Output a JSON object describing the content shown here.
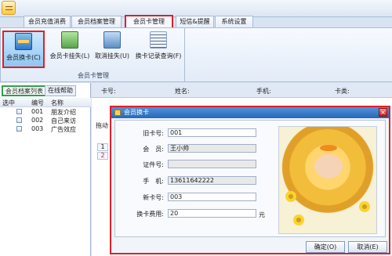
{
  "app": {
    "title_icon": "app-icon",
    "tabs": [
      "会员充值消费",
      "会员档案管理",
      "会员卡管理",
      "短信&提醒",
      "系统设置"
    ],
    "active_tab": "会员卡管理"
  },
  "ribbon": {
    "buttons": [
      "会员换卡(C)",
      "会员卡挂失(L)",
      "取消挂失(U)",
      "换卡记录查询(F)"
    ],
    "group_label": "会员卡管理"
  },
  "left_panel": {
    "tabs": [
      "会员档案列表",
      "在线帮助"
    ],
    "headers": [
      "选中",
      "编号",
      "名称"
    ],
    "rows": [
      {
        "id": "001",
        "name": "朋友介绍"
      },
      {
        "id": "002",
        "name": "自己来访"
      },
      {
        "id": "003",
        "name": "广告效应"
      }
    ]
  },
  "background": {
    "labels": [
      "卡号:",
      "姓名:",
      "手机:",
      "卡类:"
    ],
    "row_numbers": [
      "1",
      "2"
    ],
    "grid_header": "拖动"
  },
  "dialog": {
    "title": "会员换卡",
    "fields": [
      {
        "label": "旧卡号:",
        "value": "001"
      },
      {
        "label": "会　员:",
        "value": "王小帅"
      },
      {
        "label": "证件号:",
        "value": ""
      },
      {
        "label": "手　机:",
        "value": "13611642222"
      },
      {
        "label": "新卡号:",
        "value": "003"
      },
      {
        "label": "换卡费用:",
        "value": "20",
        "unit": "元"
      }
    ],
    "ok_label": "确定(O)",
    "cancel_label": "取消(E)",
    "close_icon": "close-icon"
  }
}
